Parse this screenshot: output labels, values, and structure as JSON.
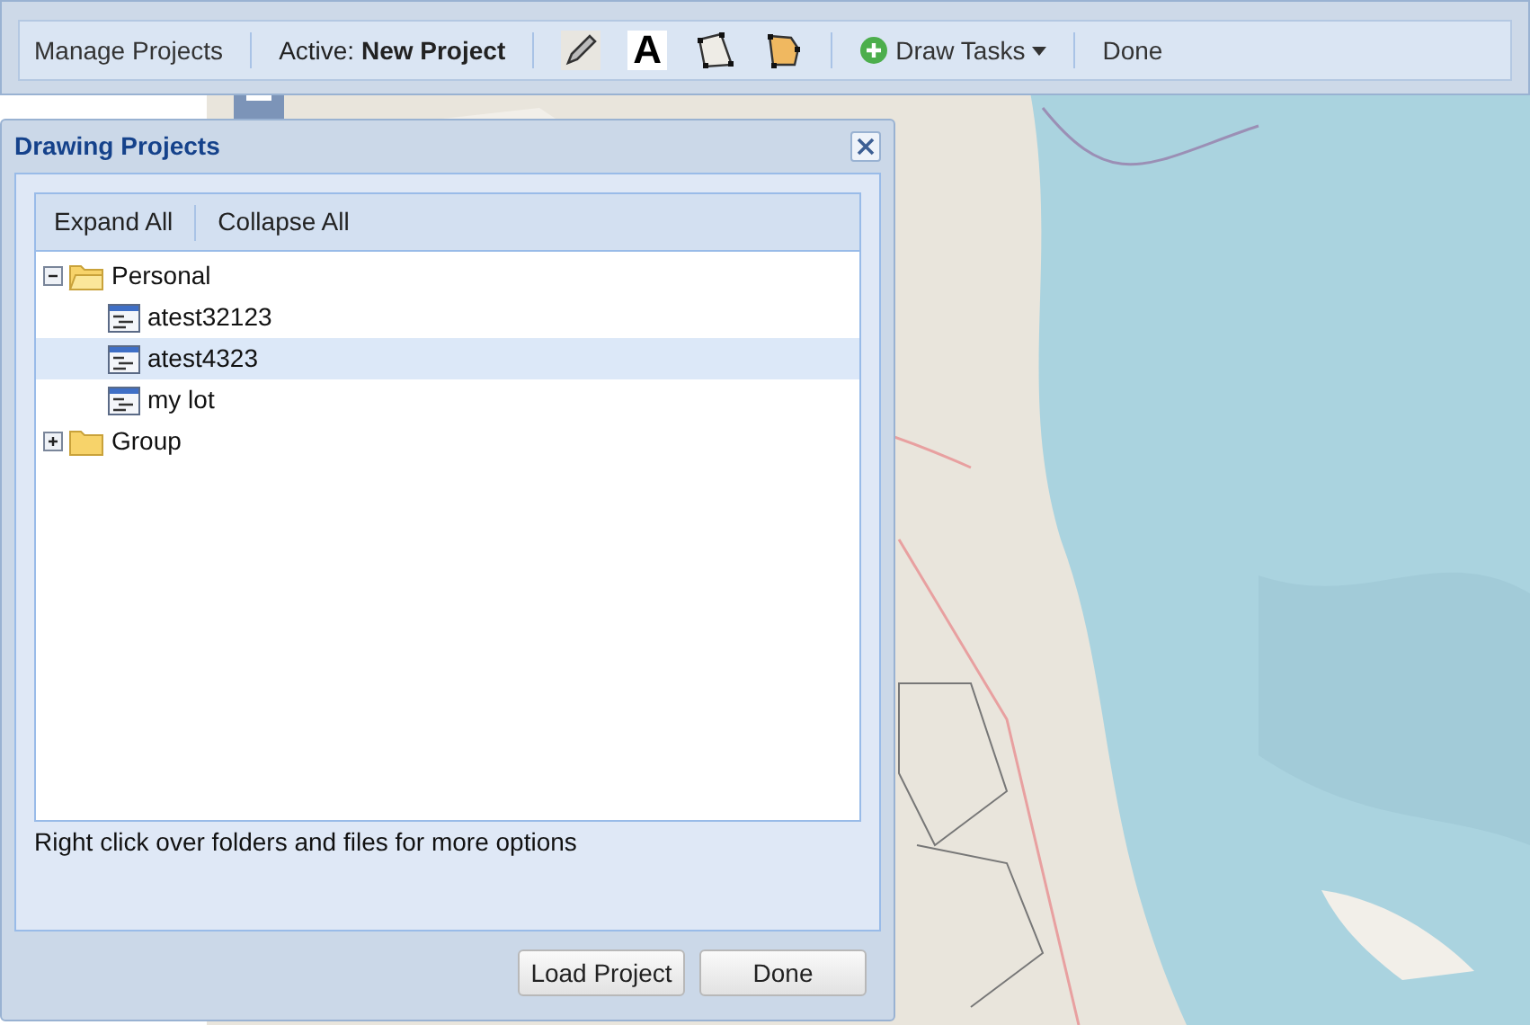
{
  "toolbar": {
    "manage": "Manage Projects",
    "active_label": "Active:",
    "active_project": "New Project",
    "tools": [
      {
        "kind": "pencil"
      },
      {
        "kind": "text",
        "glyph": "A"
      },
      {
        "kind": "polygon"
      },
      {
        "kind": "filled"
      }
    ],
    "draw_tasks": "Draw Tasks",
    "done": "Done"
  },
  "dialog": {
    "title": "Drawing Projects",
    "tree_actions": [
      "Expand All",
      "Collapse All"
    ],
    "tree": [
      {
        "label": "Personal",
        "kind": "folder",
        "expanded": true,
        "selected": false,
        "children": [
          {
            "label": "atest32123",
            "kind": "file",
            "selected": false
          },
          {
            "label": "atest4323",
            "kind": "file",
            "selected": true
          },
          {
            "label": "my lot",
            "kind": "file",
            "selected": false
          }
        ]
      },
      {
        "label": "Group",
        "kind": "folder",
        "expanded": false,
        "selected": false
      }
    ],
    "hint": "Right click over folders and files for more options",
    "buttons": [
      "Load Project",
      "Done"
    ]
  }
}
